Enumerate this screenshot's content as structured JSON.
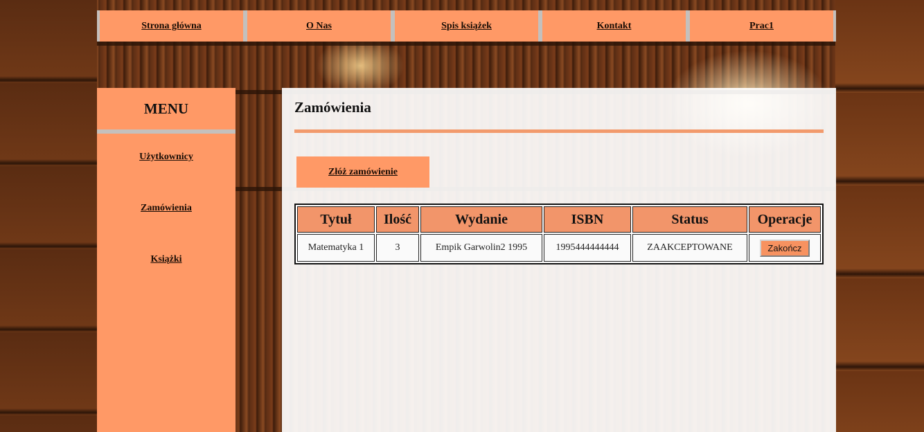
{
  "topnav": {
    "items": [
      {
        "label": "Strona główna"
      },
      {
        "label": "O Nas"
      },
      {
        "label": "Spis książek"
      },
      {
        "label": "Kontakt"
      },
      {
        "label": "Prac1"
      }
    ]
  },
  "sidebar": {
    "title": "MENU",
    "items": [
      {
        "label": "Użytkownicy"
      },
      {
        "label": "Zamówienia"
      },
      {
        "label": "Książki"
      }
    ]
  },
  "main": {
    "title": "Zamówienia",
    "order_button": "Złóż zamówienie",
    "table": {
      "headers": [
        "Tytuł",
        "Ilość",
        "Wydanie",
        "ISBN",
        "Status",
        "Operacje"
      ],
      "rows": [
        {
          "title": "Matematyka 1",
          "quantity": "3",
          "edition": "Empik Garwolin2 1995",
          "isbn": "1995444444444",
          "status": "ZAAKCEPTOWANE",
          "action": "Zakończ"
        }
      ]
    }
  },
  "colors": {
    "accent": "#ff9966",
    "header_cell": "#f2956a",
    "divider": "#c4c0bd"
  }
}
